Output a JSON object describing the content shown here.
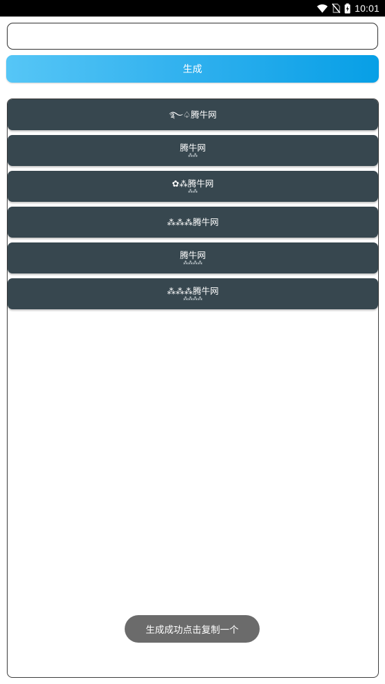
{
  "status_bar": {
    "time": "10:01",
    "icons": [
      "wifi-icon",
      "no-sim-icon",
      "battery-charging-icon"
    ]
  },
  "input": {
    "value": "",
    "placeholder": ""
  },
  "generate_button": {
    "label": "生成",
    "gradient": [
      "#56c6f6",
      "#079fe6"
    ]
  },
  "results": [
    {
      "main": "࿐♤腾牛网",
      "sub": ""
    },
    {
      "main": "腾牛网",
      "sub": "⁂⁂"
    },
    {
      "main": "✿⁂腾牛网",
      "sub": "⁂⁂"
    },
    {
      "main": "⁂⁂⁂腾牛网",
      "sub": ""
    },
    {
      "main": "腾牛网",
      "sub": "⁂⁂⁂⁂"
    },
    {
      "main": "⁂⁂⁂腾牛网",
      "sub": "⁂⁂⁂⁂"
    }
  ],
  "toast": {
    "text": "生成成功点击复制一个"
  },
  "colors": {
    "item_background": "#37474f",
    "toast_background": "#6b6b6b",
    "status_bar": "#000000"
  }
}
